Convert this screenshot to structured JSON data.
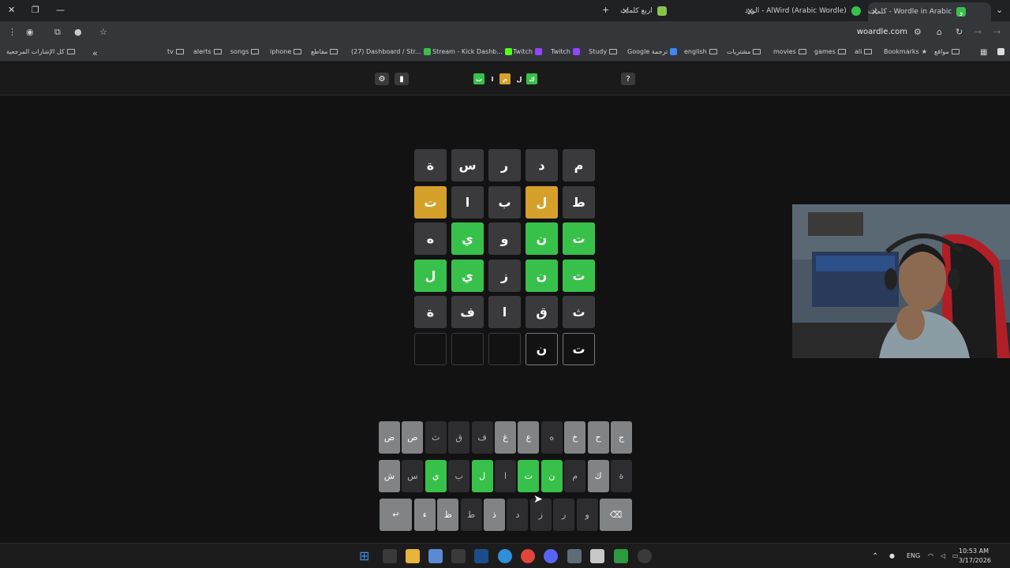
{
  "browser": {
    "tabs": [
      {
        "title": "Wordle in Arabic - كلمات",
        "favicon_color": "#38c14a",
        "favicon_glyph": "و",
        "active": true
      },
      {
        "title": "AlWird (Arabic Wordle) - الورد",
        "favicon_color": "#38c14a",
        "favicon_glyph": "",
        "active": false
      },
      {
        "title": "أربع كلمات",
        "favicon_color": "#8bc34a",
        "favicon_glyph": "",
        "active": false
      }
    ],
    "new_tab_icon": "plus-icon",
    "url": "woardle.com",
    "bookmarks": [
      "Bookmarks",
      "ali",
      "games",
      "movies",
      "مشتريات",
      "english",
      "Google ترجمة",
      "Study",
      "Twitch",
      "Twitch",
      "Stream - Kick Dashb...",
      "(27) Dashboard / Str...",
      "مقاطع",
      "iphone",
      "songs",
      "alerts",
      "tv"
    ],
    "bookmark_left": "مواقع",
    "all_bookmarks": "كل الإشارات المرجعية"
  },
  "game": {
    "logo_letters": [
      {
        "letter": "ك",
        "state": "correct"
      },
      {
        "letter": "ل",
        "state": "plain"
      },
      {
        "letter": "م",
        "state": "present"
      },
      {
        "letter": "ا",
        "state": "plain"
      },
      {
        "letter": "ت",
        "state": "correct"
      }
    ],
    "help_label": "?",
    "board": [
      [
        {
          "l": "م",
          "s": "absent"
        },
        {
          "l": "د",
          "s": "absent"
        },
        {
          "l": "ر",
          "s": "absent"
        },
        {
          "l": "س",
          "s": "absent"
        },
        {
          "l": "ة",
          "s": "absent"
        }
      ],
      [
        {
          "l": "ط",
          "s": "absent"
        },
        {
          "l": "ل",
          "s": "present"
        },
        {
          "l": "ب",
          "s": "absent"
        },
        {
          "l": "ا",
          "s": "absent"
        },
        {
          "l": "ت",
          "s": "present"
        }
      ],
      [
        {
          "l": "ت",
          "s": "correct"
        },
        {
          "l": "ن",
          "s": "correct"
        },
        {
          "l": "و",
          "s": "absent"
        },
        {
          "l": "ي",
          "s": "correct"
        },
        {
          "l": "ه",
          "s": "absent"
        }
      ],
      [
        {
          "l": "ت",
          "s": "correct"
        },
        {
          "l": "ن",
          "s": "correct"
        },
        {
          "l": "ز",
          "s": "absent"
        },
        {
          "l": "ي",
          "s": "correct"
        },
        {
          "l": "ل",
          "s": "correct"
        }
      ],
      [
        {
          "l": "ث",
          "s": "absent"
        },
        {
          "l": "ق",
          "s": "absent"
        },
        {
          "l": "ا",
          "s": "absent"
        },
        {
          "l": "ف",
          "s": "absent"
        },
        {
          "l": "ة",
          "s": "absent"
        }
      ],
      [
        {
          "l": "ت",
          "s": "typed"
        },
        {
          "l": "ن",
          "s": "typed"
        },
        {
          "l": "",
          "s": "empty"
        },
        {
          "l": "",
          "s": "empty"
        },
        {
          "l": "",
          "s": "empty"
        }
      ]
    ],
    "keyboard": [
      [
        {
          "k": "ج",
          "s": "unused"
        },
        {
          "k": "ح",
          "s": "unused"
        },
        {
          "k": "خ",
          "s": "unused"
        },
        {
          "k": "ه",
          "s": "absent"
        },
        {
          "k": "ع",
          "s": "unused"
        },
        {
          "k": "غ",
          "s": "unused"
        },
        {
          "k": "ف",
          "s": "absent"
        },
        {
          "k": "ق",
          "s": "absent"
        },
        {
          "k": "ث",
          "s": "absent"
        },
        {
          "k": "ص",
          "s": "unused"
        },
        {
          "k": "ض",
          "s": "unused"
        }
      ],
      [
        {
          "k": "ة",
          "s": "absent"
        },
        {
          "k": "ك",
          "s": "unused"
        },
        {
          "k": "م",
          "s": "absent"
        },
        {
          "k": "ن",
          "s": "correct"
        },
        {
          "k": "ت",
          "s": "correct"
        },
        {
          "k": "ا",
          "s": "absent"
        },
        {
          "k": "ل",
          "s": "correct"
        },
        {
          "k": "ب",
          "s": "absent"
        },
        {
          "k": "ي",
          "s": "correct"
        },
        {
          "k": "س",
          "s": "absent"
        },
        {
          "k": "ش",
          "s": "unused"
        }
      ],
      [
        {
          "k": "⌫",
          "s": "unused",
          "wide": true
        },
        {
          "k": "و",
          "s": "absent"
        },
        {
          "k": "ر",
          "s": "absent"
        },
        {
          "k": "ز",
          "s": "absent"
        },
        {
          "k": "د",
          "s": "absent"
        },
        {
          "k": "ذ",
          "s": "unused"
        },
        {
          "k": "ط",
          "s": "absent"
        },
        {
          "k": "ظ",
          "s": "unused"
        },
        {
          "k": "ء",
          "s": "unused"
        },
        {
          "k": "↵",
          "s": "unused",
          "wide": true
        }
      ]
    ]
  },
  "taskbar": {
    "lang": "ENG",
    "time": "10:53 AM",
    "date": "3/17/2026"
  },
  "colors": {
    "correct": "#38c14a",
    "present": "#d6a12a",
    "absent": "#3a3a3c"
  }
}
